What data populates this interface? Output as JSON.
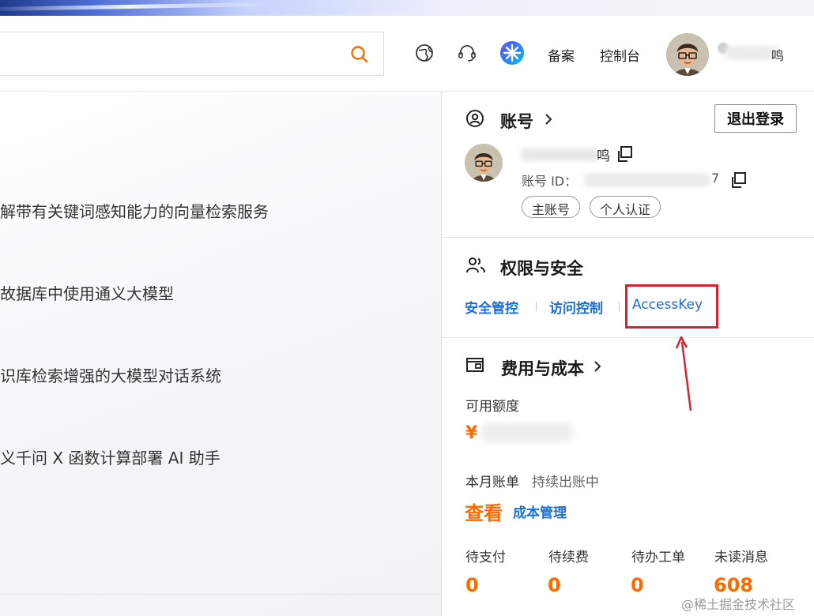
{
  "header": {
    "search_placeholder": "",
    "nav": {
      "filing": "备案",
      "console": "控制台"
    },
    "user_name_suffix": "鸣"
  },
  "left": {
    "items": [
      "解带有关键词感知能力的向量检索服务",
      "故据库中使用通义大模型",
      "识库检索增强的大模型对话系统",
      "义千问 X 函数计算部署 AI 助手"
    ]
  },
  "panel": {
    "account": {
      "title": "账号",
      "logout_label": "退出登录",
      "name_suffix": "鸣",
      "id_label": "账号 ID：",
      "id_suffix": "7",
      "tags": [
        "主账号",
        "个人认证"
      ]
    },
    "security": {
      "title": "权限与安全",
      "links": [
        "安全管控",
        "访问控制",
        "AccessKey"
      ]
    },
    "cost": {
      "title": "费用与成本",
      "available_label": "可用额度",
      "currency_symbol": "¥",
      "bill_label": "本月账单",
      "bill_status": "持续出账中",
      "view_label": "查看",
      "cost_mgmt_label": "成本管理",
      "stats": [
        {
          "label": "待支付",
          "value": "0"
        },
        {
          "label": "待续费",
          "value": "0"
        },
        {
          "label": "待办工单",
          "value": "0"
        },
        {
          "label": "未读消息",
          "value": "608"
        }
      ]
    }
  },
  "watermark": "@稀土掘金技术社区",
  "colors": {
    "link": "#1b6fd6",
    "accent": "#ff6a00",
    "highlight": "#d52232"
  }
}
